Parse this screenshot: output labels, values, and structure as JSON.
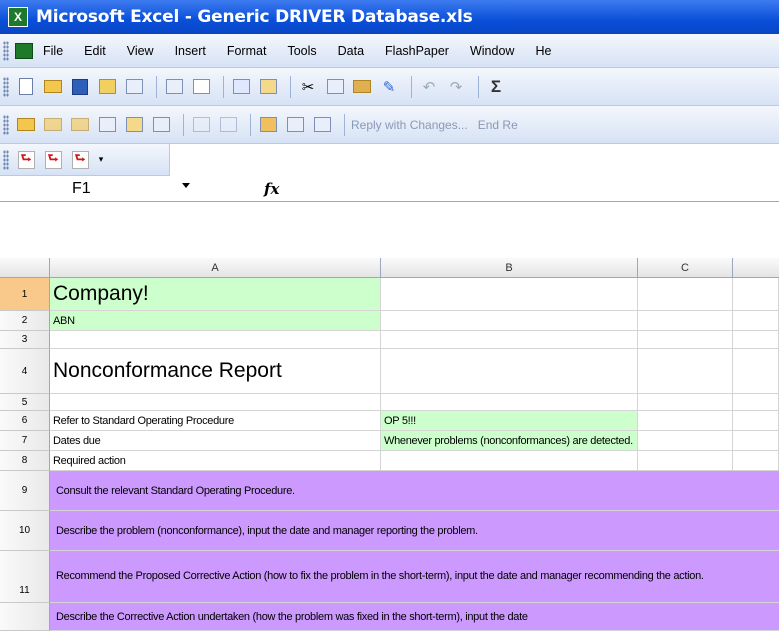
{
  "window": {
    "title": "Microsoft Excel - Generic DRIVER Database.xls",
    "app_icon": "excel-icon"
  },
  "menu": [
    "File",
    "Edit",
    "View",
    "Insert",
    "Format",
    "Tools",
    "Data",
    "FlashPaper",
    "Window",
    "He"
  ],
  "toolbar2": {
    "reply_label": "Reply with Changes...",
    "end_label": "End Re"
  },
  "formula_bar": {
    "name_box": "F1",
    "fx_label": "fx",
    "content": ""
  },
  "columns": [
    "A",
    "B",
    "C"
  ],
  "rows": [
    {
      "num": "1",
      "a": "Company!",
      "b": ""
    },
    {
      "num": "2",
      "a": "ABN",
      "b": ""
    },
    {
      "num": "3",
      "a": "",
      "b": ""
    },
    {
      "num": "4",
      "a": "Nonconformance Report",
      "b": ""
    },
    {
      "num": "5",
      "a": "",
      "b": ""
    },
    {
      "num": "6",
      "a": "Refer to Standard Operating Procedure",
      "b": "OP 5!!!"
    },
    {
      "num": "7",
      "a": "Dates due",
      "b": "Whenever problems (nonconformances) are detected."
    },
    {
      "num": "8",
      "a": "Required action",
      "b": ""
    },
    {
      "num": "9",
      "a": "Consult the relevant Standard Operating Procedure.",
      "b": ""
    },
    {
      "num": "10",
      "a": "Describe the problem (nonconformance), input the date and manager reporting the problem.",
      "b": ""
    },
    {
      "num": "11",
      "a": "Recommend the Proposed Corrective Action (how to fix the problem in the short-term), input the date and manager recommending the action.",
      "b": ""
    },
    {
      "num": "",
      "a": "Describe the Corrective Action undertaken (how the problem was fixed in the short-term), input the date",
      "b": ""
    }
  ],
  "colors": {
    "title_bar": "#0a4fd9",
    "green_fill": "#ccffcc",
    "purple_fill": "#cc99ff",
    "selected_row_header": "#f8c98a"
  }
}
